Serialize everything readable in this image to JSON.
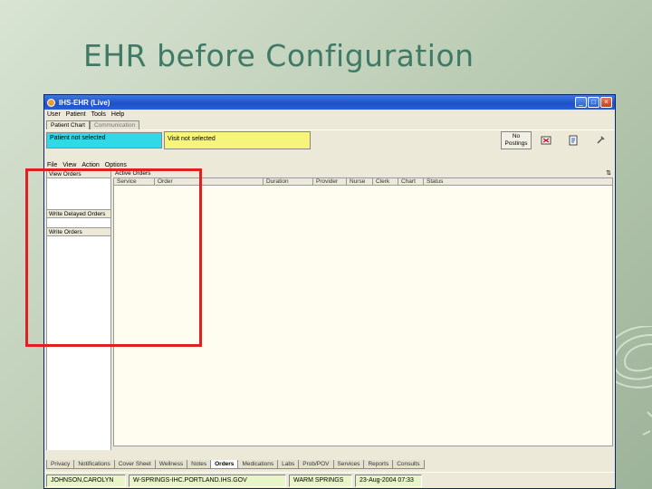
{
  "slide": {
    "title": "EHR before Configuration"
  },
  "window": {
    "title": "IHS-EHR (Live)",
    "controls": {
      "minimize": "_",
      "maximize": "□",
      "close": "×"
    }
  },
  "menubar": [
    "User",
    "Patient",
    "Tools",
    "Help"
  ],
  "top_tabs": [
    "Patient Chart",
    "Communication"
  ],
  "context": {
    "patient": "Patient not selected",
    "visit": "Visit not selected",
    "postings_line1": "No",
    "postings_line2": "Postings"
  },
  "orders_menubar": [
    "File",
    "View",
    "Action",
    "Options"
  ],
  "left_pane": {
    "view_orders": "View Orders",
    "write_delayed": "Write Delayed Orders",
    "write_orders": "Write Orders"
  },
  "active_orders": {
    "label": "Active Orders",
    "columns": [
      "Service",
      "Order",
      "Duration",
      "Provider",
      "Nurse",
      "Clerk",
      "Chart",
      "Status"
    ]
  },
  "bottom_tabs": [
    "Privacy",
    "Notifications",
    "Cover Sheet",
    "Wellness",
    "Notes",
    "Orders",
    "Medications",
    "Labs",
    "Prob/POV",
    "Services",
    "Reports",
    "Consults"
  ],
  "active_bottom_tab": "Orders",
  "statusbar": [
    "JOHNSON,CAROLYN",
    "W-SPRINGS-IHC.PORTLAND.IHS.GOV",
    "WARM SPRINGS",
    "23-Aug-2004 07:33"
  ],
  "colors": {
    "patient_box": "#2fd9e8",
    "visit_box": "#f6f47a",
    "highlight": "#e02020",
    "title": "#3f7a66"
  }
}
